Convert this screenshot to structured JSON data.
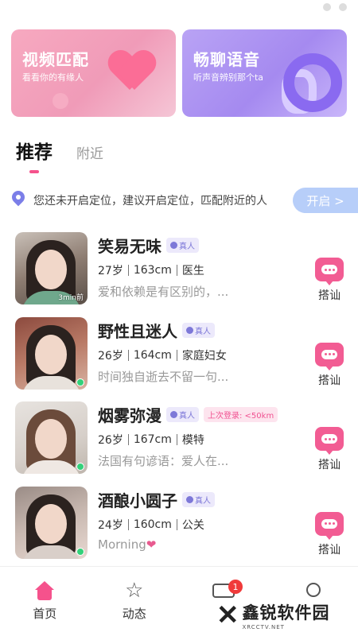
{
  "banners": {
    "video": {
      "title": "视频匹配",
      "subtitle": "看看你的有缘人"
    },
    "voice": {
      "title": "畅聊语音",
      "subtitle": "听声音辨别那个ta"
    }
  },
  "tabs": [
    {
      "label": "推荐",
      "active": true
    },
    {
      "label": "附近",
      "active": false
    }
  ],
  "location": {
    "message": "您还未开启定位，建议开启定位，匹配附近的人",
    "button_label": "开启 >"
  },
  "users": [
    {
      "name": "笑易无味",
      "badge": "真人",
      "age": "27岁",
      "height": "163cm",
      "job": "医生",
      "intro": "爱和依赖是有区别的，...",
      "time_tag": "3min前",
      "greet_label": "搭讪"
    },
    {
      "name": "野性且迷人",
      "badge": "真人",
      "age": "26岁",
      "height": "164cm",
      "job": "家庭妇女",
      "intro": "时间独自逝去不留一句...",
      "greet_label": "搭讪"
    },
    {
      "name": "烟雾弥漫",
      "badge": "真人",
      "login": "上次登录: <50km",
      "age": "26岁",
      "height": "167cm",
      "job": "模特",
      "intro": "法国有句谚语：爱人在...",
      "greet_label": "搭讪"
    },
    {
      "name": "酒酿小圆子",
      "badge": "真人",
      "age": "24岁",
      "height": "160cm",
      "job": "公关",
      "intro": "Morning",
      "greet_label": "搭讪"
    }
  ],
  "nav": {
    "home": "首页",
    "moments": "动态",
    "message_badge": "1"
  },
  "watermark": {
    "main": "鑫锐软件园",
    "sub": "XRCCTV.NET"
  },
  "colors": {
    "accent": "#f5528c",
    "verified": "#7d78d8",
    "open_button": "#b7cef9"
  }
}
